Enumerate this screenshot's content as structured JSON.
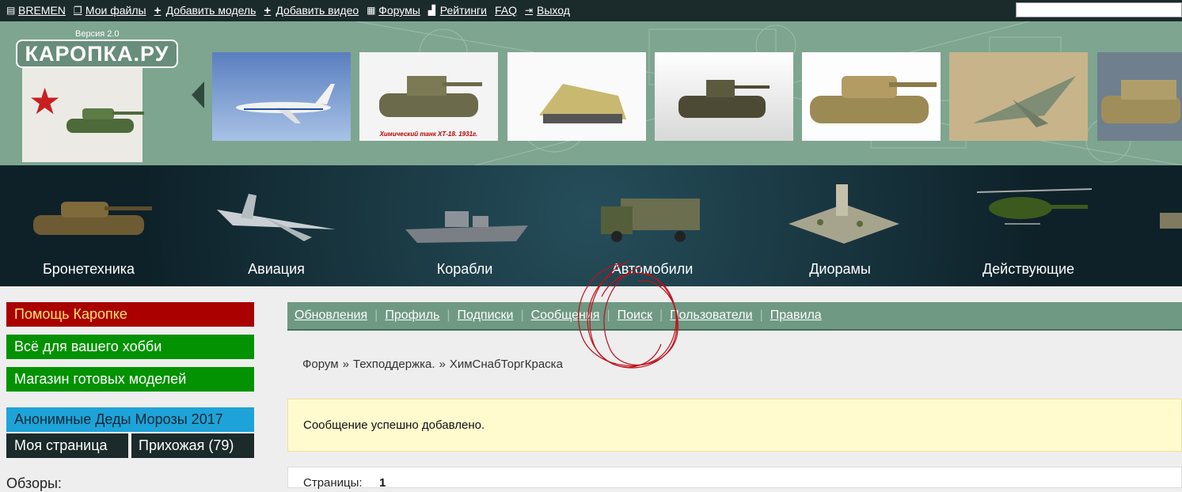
{
  "topbar": {
    "links": [
      {
        "label": "BREMEN",
        "icon": "user-card-icon"
      },
      {
        "label": "Мои файлы",
        "icon": "files-icon"
      },
      {
        "label": "Добавить модель",
        "icon": "plus-icon"
      },
      {
        "label": "Добавить видео",
        "icon": "plus-icon"
      },
      {
        "label": "Форумы",
        "icon": "forum-icon"
      },
      {
        "label": "Рейтинги",
        "icon": "chart-icon"
      },
      {
        "label": "FAQ",
        "icon": ""
      },
      {
        "label": "Выход",
        "icon": "exit-icon"
      }
    ],
    "search_value": ""
  },
  "header": {
    "logo_text": "КАРОПКА.РУ",
    "version": "Версия 2.0",
    "thumb_caption": "Химический танк ХТ-18. 1931г."
  },
  "categories": [
    "Бронетехника",
    "Авиация",
    "Корабли",
    "Автомобили",
    "Диорамы",
    "Действующие"
  ],
  "sidebar": {
    "help": "Помощь Каропке",
    "hobby": "Всё для вашего хобби",
    "shop": "Магазин готовых моделей",
    "santa": "Анонимные Деды Морозы 2017",
    "my_page": "Моя страница",
    "hallway": "Прихожая (79)",
    "reviews": "Обзоры:"
  },
  "forum_nav": {
    "items": [
      "Обновления",
      "Профиль",
      "Подписки",
      "Сообщения",
      "Поиск",
      "Пользователи",
      "Правила"
    ]
  },
  "breadcrumb": {
    "items": [
      "Форум",
      "Техподдержка.",
      "ХимСнабТоргКраска"
    ],
    "separator": "»"
  },
  "notice": {
    "text": "Сообщение успешно добавлено."
  },
  "pages": {
    "label": "Страницы:",
    "current": "1"
  },
  "colors": {
    "topbar": "#1b2a2a",
    "header": "#7ea590",
    "help": "#aa0000",
    "green": "#029202",
    "santa": "#1ea3d9",
    "navbar": "#6f9983",
    "notice": "#fffbcf"
  }
}
